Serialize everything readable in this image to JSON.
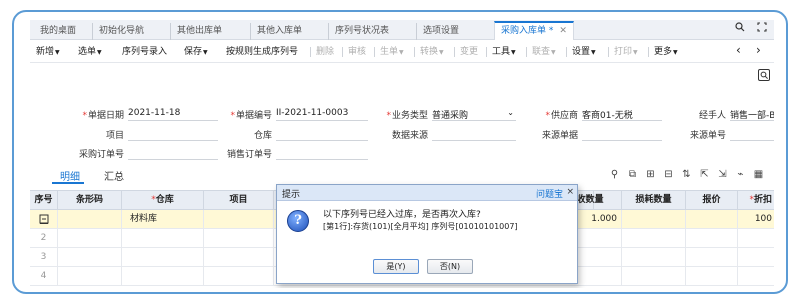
{
  "tabs": [
    {
      "label": "我的桌面"
    },
    {
      "label": "初始化导航"
    },
    {
      "label": "其他出库单"
    },
    {
      "label": "其他入库单"
    },
    {
      "label": "序列号状况表"
    },
    {
      "label": "选项设置"
    },
    {
      "label": "采购入库单 *",
      "active": true
    }
  ],
  "toolbar": {
    "items": [
      {
        "label": "新增",
        "caret": true,
        "disabled": false
      },
      {
        "label": "选单",
        "caret": true,
        "disabled": false
      },
      {
        "label": "序列号录入",
        "caret": false,
        "disabled": false
      },
      {
        "label": "保存",
        "caret": true,
        "disabled": false
      },
      {
        "label": "按规则生成序列号",
        "caret": false,
        "disabled": false
      },
      {
        "label": "删除",
        "caret": false,
        "disabled": true
      },
      {
        "label": "审核",
        "caret": false,
        "disabled": true
      },
      {
        "label": "生单",
        "caret": true,
        "disabled": true
      },
      {
        "label": "转换",
        "caret": true,
        "disabled": true
      },
      {
        "label": "变更",
        "caret": false,
        "disabled": true
      },
      {
        "label": "工具",
        "caret": true,
        "disabled": false
      },
      {
        "label": "联查",
        "caret": true,
        "disabled": true
      },
      {
        "label": "设置",
        "caret": true,
        "disabled": false
      },
      {
        "label": "打印",
        "caret": true,
        "disabled": true
      },
      {
        "label": "更多",
        "caret": true,
        "disabled": false
      }
    ]
  },
  "form": {
    "doc_date_label": "单据日期",
    "doc_date_value": "2021-11-18",
    "doc_no_label": "单据编号",
    "doc_no_value": "II-2021-11-0003",
    "biz_type_label": "业务类型",
    "biz_type_value": "普通采购",
    "supplier_label": "供应商",
    "supplier_value": "客商01-无税",
    "handler_label": "经手人",
    "handler_value": "销售一部-B",
    "project_label": "项目",
    "warehouse_label": "仓库",
    "data_source_label": "数据来源",
    "src_doc_no_label": "来源单据",
    "src_no_label": "来源单号",
    "po_no_label": "采购订单号",
    "so_no_label": "销售订单号"
  },
  "subtabs": {
    "detail": "明细",
    "summary": "汇总"
  },
  "grid": {
    "headers": {
      "seq": "序号",
      "barcode": "条形码",
      "warehouse": "仓库",
      "project": "项目",
      "recv_qty": "实收数量",
      "loss_qty": "损耗数量",
      "price": "报价",
      "discount": "折扣"
    },
    "rows": [
      {
        "seq": "",
        "warehouse": "材料库",
        "recv_qty": "1.000",
        "discount": "100"
      },
      {
        "seq": "2"
      },
      {
        "seq": "3"
      },
      {
        "seq": "4"
      }
    ]
  },
  "dialog": {
    "title": "提示",
    "brand": "问题宝",
    "close": "×",
    "message": "以下序列号已经入过库，是否再次入库?",
    "detail": "[第1行]:存货(101)[全月平均] 序列号[01010101007]",
    "yes_label": "是(Y)",
    "no_label": "否(N)"
  },
  "colors": {
    "accent": "#1976d2",
    "required": "#e53935",
    "selected_row": "#fff9d6",
    "frame": "#5b9bd5"
  }
}
